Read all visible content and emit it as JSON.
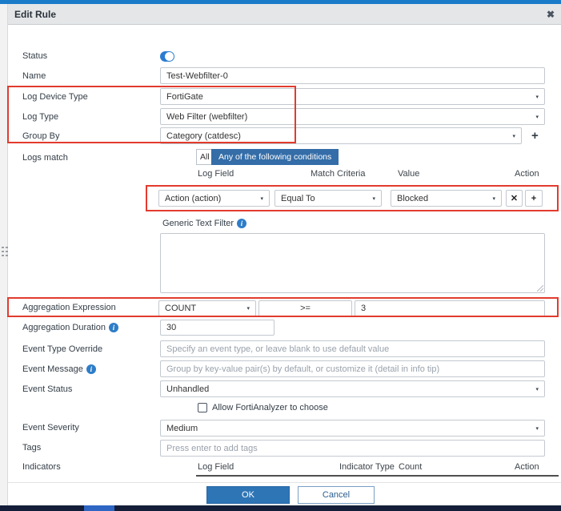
{
  "window": {
    "title": "Edit Rule"
  },
  "icons": {
    "chevron_down": "▾",
    "close": "✖",
    "plus": "+",
    "remove": "✕",
    "info": "i"
  },
  "rows": {
    "status": {
      "label": "Status",
      "state": "on"
    },
    "name": {
      "label": "Name",
      "value": "Test-Webfilter-0"
    },
    "log_device_type": {
      "label": "Log Device Type",
      "value": "FortiGate"
    },
    "log_type": {
      "label": "Log Type",
      "value": "Web Filter (webfilter)"
    },
    "group_by": {
      "label": "Group By",
      "value": "Category (catdesc)"
    },
    "logs_match": {
      "label": "Logs match",
      "option_all": "All",
      "option_any": "Any of the following conditions",
      "selected": "Any of the following conditions"
    },
    "conditions": {
      "headers": [
        "Log Field",
        "Match Criteria",
        "Value",
        "Action"
      ],
      "row": {
        "log_field": "Action (action)",
        "match_criteria": "Equal To",
        "value": "Blocked"
      }
    },
    "generic_text_filter": {
      "label": "Generic Text Filter",
      "value": ""
    },
    "aggregation_expression": {
      "label": "Aggregation Expression",
      "function": "COUNT",
      "operator": ">=",
      "value": "3"
    },
    "aggregation_duration": {
      "label": "Aggregation Duration",
      "value": "30"
    },
    "event_type_override": {
      "label": "Event Type Override",
      "placeholder": "Specify an event type, or leave blank to use default value"
    },
    "event_message": {
      "label": "Event Message",
      "placeholder": "Group by key-value pair(s) by default, or customize it (detail in info tip)"
    },
    "event_status": {
      "label": "Event Status",
      "value": "Unhandled",
      "checkbox_label": "Allow FortiAnalyzer to choose",
      "checkbox_checked": false
    },
    "event_severity": {
      "label": "Event Severity",
      "value": "Medium"
    },
    "tags": {
      "label": "Tags",
      "placeholder": "Press enter to add tags"
    },
    "indicators": {
      "label": "Indicators",
      "headers": [
        "Log Field",
        "Indicator Type",
        "Count",
        "Action"
      ]
    }
  },
  "footer": {
    "ok": "OK",
    "cancel": "Cancel"
  },
  "colors": {
    "annotation_red": "#e23b2e",
    "top_strip_blue": "#1a7bc9",
    "segmented_blue": "#346da8",
    "toggle_blue": "#2b7cd0",
    "ok_blue": "#2e75b6",
    "info_blue": "#2e7dc8",
    "bottom_bar_navy": "#141e38"
  }
}
